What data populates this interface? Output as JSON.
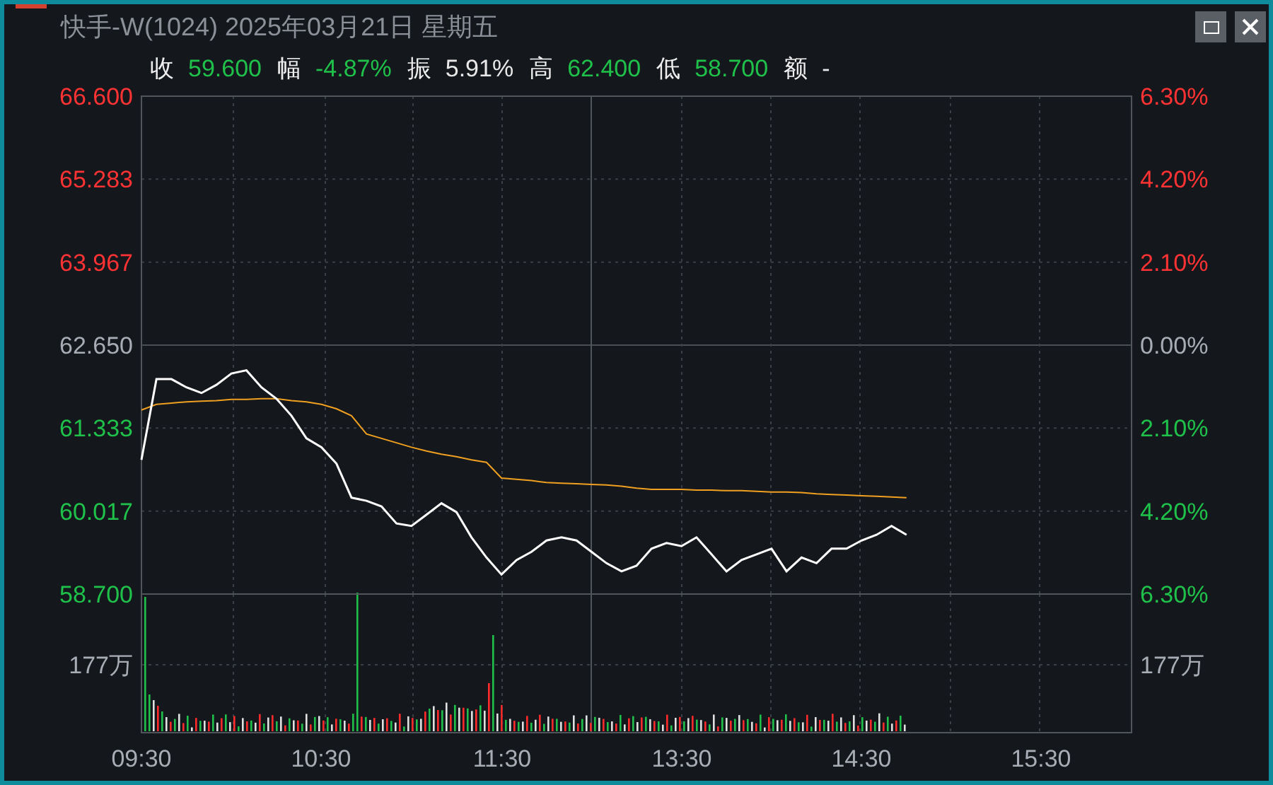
{
  "window": {
    "title": "快手-W(1024) 2025年03月21日 星期五"
  },
  "quote": [
    {
      "label": "收",
      "value": "59.600",
      "color": "#1fc14a"
    },
    {
      "label": "幅",
      "value": "-4.87%",
      "color": "#1fc14a"
    },
    {
      "label": "振",
      "value": "5.91%",
      "color": "#e8e8e8"
    },
    {
      "label": "高",
      "value": "62.400",
      "color": "#1fc14a"
    },
    {
      "label": "低",
      "value": "58.700",
      "color": "#1fc14a"
    },
    {
      "label": "额",
      "value": "-",
      "color": "#e8e8e8"
    }
  ],
  "percent_axis": [
    {
      "label": "6.30%",
      "color": "#ff3333"
    },
    {
      "label": "4.20%",
      "color": "#ff3333"
    },
    {
      "label": "2.10%",
      "color": "#ff3333"
    },
    {
      "label": "0.00%",
      "color": "#a8adb5"
    },
    {
      "label": "2.10%",
      "color": "#1fc14a"
    },
    {
      "label": "4.20%",
      "color": "#1fc14a"
    },
    {
      "label": "6.30%",
      "color": "#1fc14a"
    }
  ],
  "volume_axis": {
    "left": "177万",
    "right": "177万"
  },
  "time_axis": [
    "09:30",
    "10:30",
    "11:30",
    "13:30",
    "14:30",
    "15:30"
  ],
  "chart_data": {
    "type": "line",
    "ylim": [
      58.7,
      66.6
    ],
    "grid": true,
    "yticks": [
      {
        "value": 66.6,
        "label": "66.600"
      },
      {
        "value": 65.283,
        "label": "65.283"
      },
      {
        "value": 63.967,
        "label": "63.967"
      },
      {
        "value": 62.65,
        "label": "62.650"
      },
      {
        "value": 61.333,
        "label": "61.333"
      },
      {
        "value": 60.017,
        "label": "60.017"
      },
      {
        "value": 58.7,
        "label": "58.700"
      }
    ],
    "series": [
      {
        "color": "#ffffff",
        "values": [
          60.83,
          62.11,
          62.11,
          61.98,
          61.89,
          62.02,
          62.2,
          62.25,
          61.98,
          61.8,
          61.53,
          61.17,
          61.03,
          60.77,
          60.23,
          60.18,
          60.09,
          59.82,
          59.78,
          59.96,
          60.14,
          60.0,
          59.6,
          59.28,
          59.01,
          59.24,
          59.37,
          59.55,
          59.6,
          59.55,
          59.37,
          59.19,
          59.06,
          59.15,
          59.42,
          59.51,
          59.46,
          59.6,
          59.33,
          59.06,
          59.24,
          59.33,
          59.42,
          59.06,
          59.28,
          59.19,
          59.42,
          59.42,
          59.55,
          59.64,
          59.78,
          59.64
        ]
      },
      {
        "color": "#f0a020",
        "values": [
          61.62,
          61.71,
          61.73,
          61.75,
          61.76,
          61.77,
          61.79,
          61.79,
          61.8,
          61.8,
          61.77,
          61.75,
          61.71,
          61.64,
          61.53,
          61.24,
          61.17,
          61.1,
          61.03,
          60.97,
          60.92,
          60.88,
          60.83,
          60.79,
          60.54,
          60.52,
          60.5,
          60.47,
          60.46,
          60.45,
          60.44,
          60.43,
          60.41,
          60.38,
          60.36,
          60.36,
          60.36,
          60.35,
          60.35,
          60.34,
          60.34,
          60.33,
          60.32,
          60.32,
          60.31,
          60.29,
          60.28,
          60.27,
          60.26,
          60.25,
          60.24,
          60.23
        ]
      }
    ]
  }
}
